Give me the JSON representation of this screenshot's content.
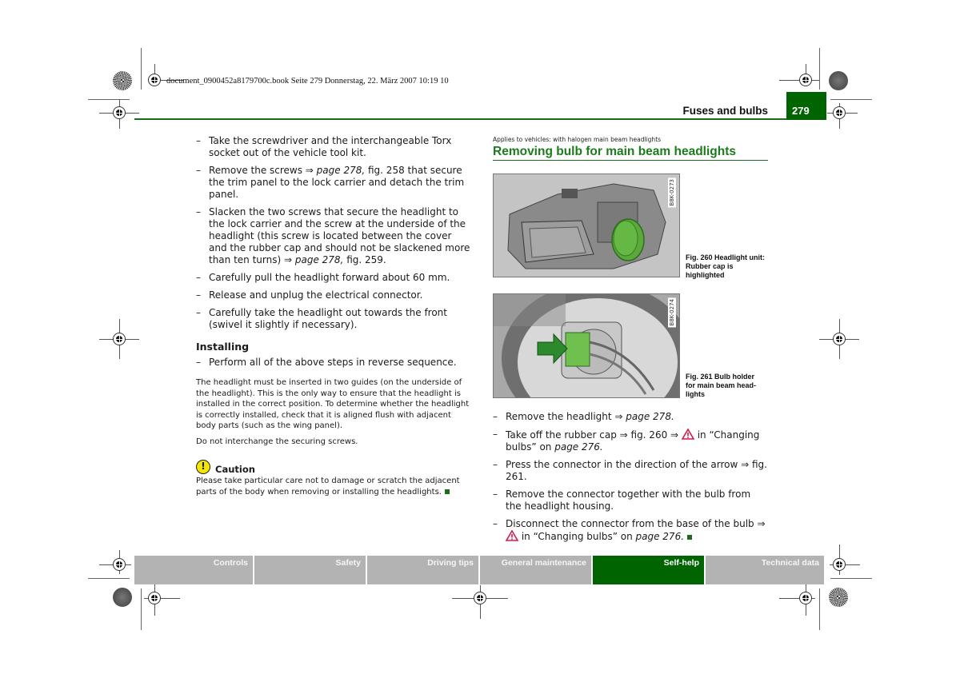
{
  "print_info": "document_0900452a8179700c.book  Seite 279  Donnerstag, 22. März 2007  10:19 10",
  "header": {
    "section_title": "Fuses and bulbs",
    "page_number": "279",
    "accent_color": "#006400"
  },
  "left_column": {
    "steps": [
      {
        "text": "Take the screwdriver and the interchangeable Torx socket out of the vehicle tool kit."
      },
      {
        "pre": "Remove the screws ⇒ ",
        "ref": "page 278,",
        "post": " fig. 258 that secure the trim panel to the lock carrier and detach the trim panel."
      },
      {
        "pre": "Slacken the two screws that secure the headlight to the lock carrier and the screw at the underside of the head­light (this screw is located between the cover and the rubber cap and should not be slackened more than ten turns) ⇒ ",
        "ref": "page 278,",
        "post": " fig. 259."
      },
      {
        "text": "Carefully pull the headlight forward about 60 mm."
      },
      {
        "text": "Release and unplug the electrical connector."
      },
      {
        "text": "Carefully take the headlight out towards the front (swivel it slightly if necessary)."
      }
    ],
    "installing_heading": "Installing",
    "installing_step": "Perform all of the above steps in reverse sequence.",
    "note_1": "The headlight must be inserted in two guides (on the underside of the headlight). This is the only way to ensure that the headlight is installed in the correct position. To determine whether the headlight is correctly installed, check that it is aligned flush with adjacent body parts (such as the wing panel).",
    "note_2": "Do not interchange the securing screws.",
    "caution": {
      "icon": "exclamation-circle-icon",
      "label": "Caution",
      "text": "Please take particular care not to damage or scratch the adjacent parts of the body when removing or installing the headlights."
    }
  },
  "right_column": {
    "applies_to": "Applies to vehicles: with halogen main beam headlights",
    "title": "Removing bulb for main beam headlights",
    "figures": [
      {
        "code": "B8K-0273",
        "caption": "Fig. 260  Headlight unit: Rubber cap is highlighted"
      },
      {
        "code": "B8K-0274",
        "caption": "Fig. 261  Bulb holder for main beam head­lights"
      }
    ],
    "steps": [
      {
        "pre": "Remove the headlight ⇒ ",
        "ref": "page 278."
      },
      {
        "pre": "Take off the rubber cap ⇒ fig. 260 ⇒ ",
        "warning": true,
        "mid": " in “Changing bulbs” on ",
        "ref": "page 276."
      },
      {
        "pre": "Press the connector in the direction of the arrow ⇒ fig. 261."
      },
      {
        "pre": " Remove the connector together with the bulb from the headlight housing."
      },
      {
        "pre": "Disconnect the connector from the base of the bulb ⇒ ",
        "warning": true,
        "mid": " in “Changing bulbs” on ",
        "ref": "page 276."
      }
    ]
  },
  "nav_tabs": [
    {
      "label": "Controls",
      "active": false
    },
    {
      "label": "Safety",
      "active": false
    },
    {
      "label": "Driving tips",
      "active": false
    },
    {
      "label": "General maintenance",
      "active": false
    },
    {
      "label": "Self-help",
      "active": true
    },
    {
      "label": "Technical data",
      "active": false
    }
  ]
}
